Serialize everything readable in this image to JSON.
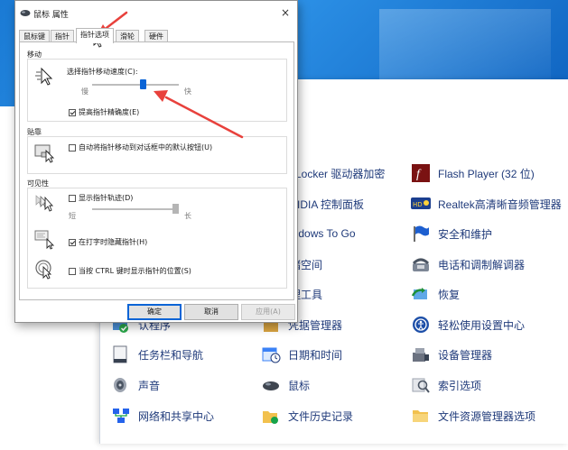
{
  "dialog": {
    "title": "鼠标 属性",
    "close_glyph": "×",
    "tabs": [
      {
        "label": "鼠标键"
      },
      {
        "label": "指针"
      },
      {
        "label": "指针选项"
      },
      {
        "label": "滑轮"
      },
      {
        "label": "硬件"
      }
    ],
    "active_tab": "指针选项",
    "motion": {
      "group": "移动",
      "speed_label": "选择指针移动速度(C):",
      "slow": "慢",
      "fast": "快",
      "speed_level_fraction": 0.6,
      "precision_label": "提高指针精确度(E)",
      "precision_checked": true
    },
    "snap_to": {
      "group": "贴靠",
      "label": "自动将指针移动到对话框中的默认按钮(U)",
      "checked": false
    },
    "visibility": {
      "group": "可见性",
      "trails_label": "显示指针轨迹(D)",
      "trails_checked": false,
      "short": "短",
      "long": "长",
      "trail_length_fraction": 1.0,
      "hide_label": "在打字时隐藏指针(H)",
      "hide_checked": true,
      "ctrl_label": "当按 CTRL 键时显示指针的位置(S)",
      "ctrl_checked": false
    },
    "buttons": {
      "ok": "确定",
      "cancel": "取消",
      "apply": "应用(A)"
    }
  },
  "control_panel": {
    "items": [
      {
        "label": "itLocker 驱动器加密"
      },
      {
        "label": "Flash Player (32 位)"
      },
      {
        "label": "VIDIA 控制面板"
      },
      {
        "label": "Realtek高清晰音频管理器"
      },
      {
        "label": "indows To Go"
      },
      {
        "label": "安全和维护"
      },
      {
        "label": "储空间"
      },
      {
        "label": "电话和调制解调器"
      },
      {
        "label": "理工具"
      },
      {
        "label": "恢复"
      },
      {
        "label": "认程序"
      },
      {
        "label": "凭据管理器"
      },
      {
        "label": "轻松使用设置中心"
      },
      {
        "label": "任务栏和导航"
      },
      {
        "label": "日期和时间"
      },
      {
        "label": "设备管理器"
      },
      {
        "label": "声音"
      },
      {
        "label": "鼠标"
      },
      {
        "label": "索引选项"
      },
      {
        "label": "网络和共享中心"
      },
      {
        "label": "文件历史记录"
      },
      {
        "label": "文件资源管理器选项"
      }
    ]
  },
  "colors": {
    "accent": "#0a64d6",
    "annotation_red": "#e8413c",
    "link_text": "#1f3a7a",
    "wallpaper": "#1a7ad4"
  }
}
